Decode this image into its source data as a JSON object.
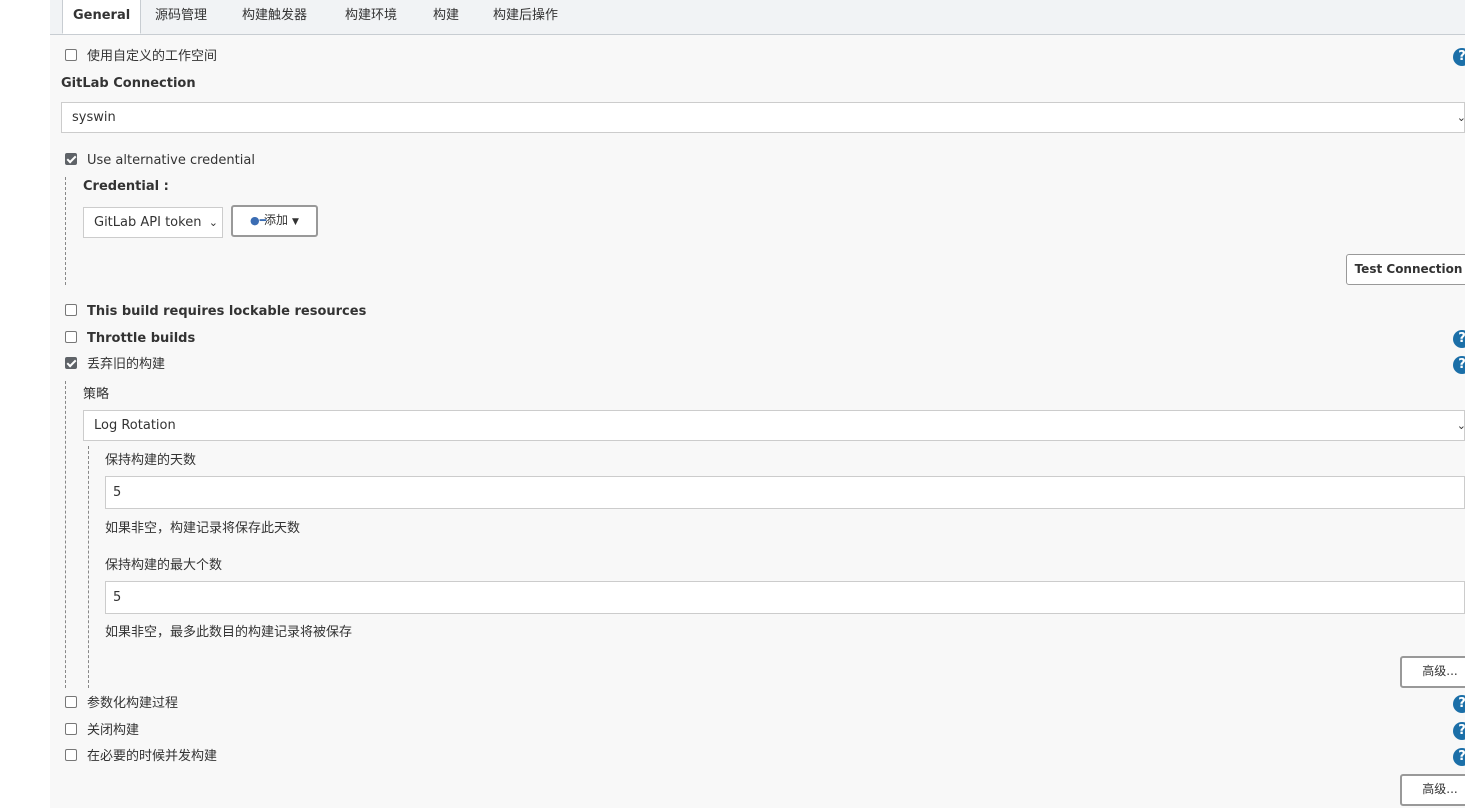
{
  "tabs": [
    {
      "label": "General"
    },
    {
      "label": "源码管理"
    },
    {
      "label": "构建触发器"
    },
    {
      "label": "构建环境"
    },
    {
      "label": "构建"
    },
    {
      "label": "构建后操作"
    }
  ],
  "options": {
    "custom_workspace": {
      "label": "使用自定义的工作空间",
      "checked": false
    },
    "gitlab_connection_label": "GitLab Connection",
    "gitlab_connection_value": "syswin",
    "alt_credential": {
      "label": "Use alternative credential",
      "checked": true
    },
    "credential_label": "Credential :",
    "credential_value": "GitLab API token",
    "add_button": "添加",
    "test_connection": "Test Connection",
    "lockable": {
      "label": "This build requires lockable resources",
      "checked": false
    },
    "throttle": {
      "label": "Throttle builds",
      "checked": false
    },
    "discard_old": {
      "label": "丢弃旧的构建",
      "checked": true
    },
    "strategy_label": "策略",
    "strategy_value": "Log Rotation",
    "days_label": "保持构建的天数",
    "days_value": "5",
    "days_hint": "如果非空，构建记录将保存此天数",
    "max_label": "保持构建的最大个数",
    "max_value": "5",
    "max_hint": "如果非空，最多此数目的构建记录将被保存",
    "advanced_1": "高级...",
    "parameterized": {
      "label": "参数化构建过程",
      "checked": false
    },
    "disable_build": {
      "label": "关闭构建",
      "checked": false
    },
    "concurrent": {
      "label": "在必要的时候并发构建",
      "checked": false
    },
    "advanced_2": "高级..."
  },
  "help_glyph": "?",
  "icons": {
    "help": "help-icon",
    "key": "key-icon",
    "dropdown": "chevron-down-icon"
  },
  "colors": {
    "help": "#1b6fa8",
    "panel_bg": "#f8f8f8",
    "tab_bar": "#f1f3f5"
  }
}
